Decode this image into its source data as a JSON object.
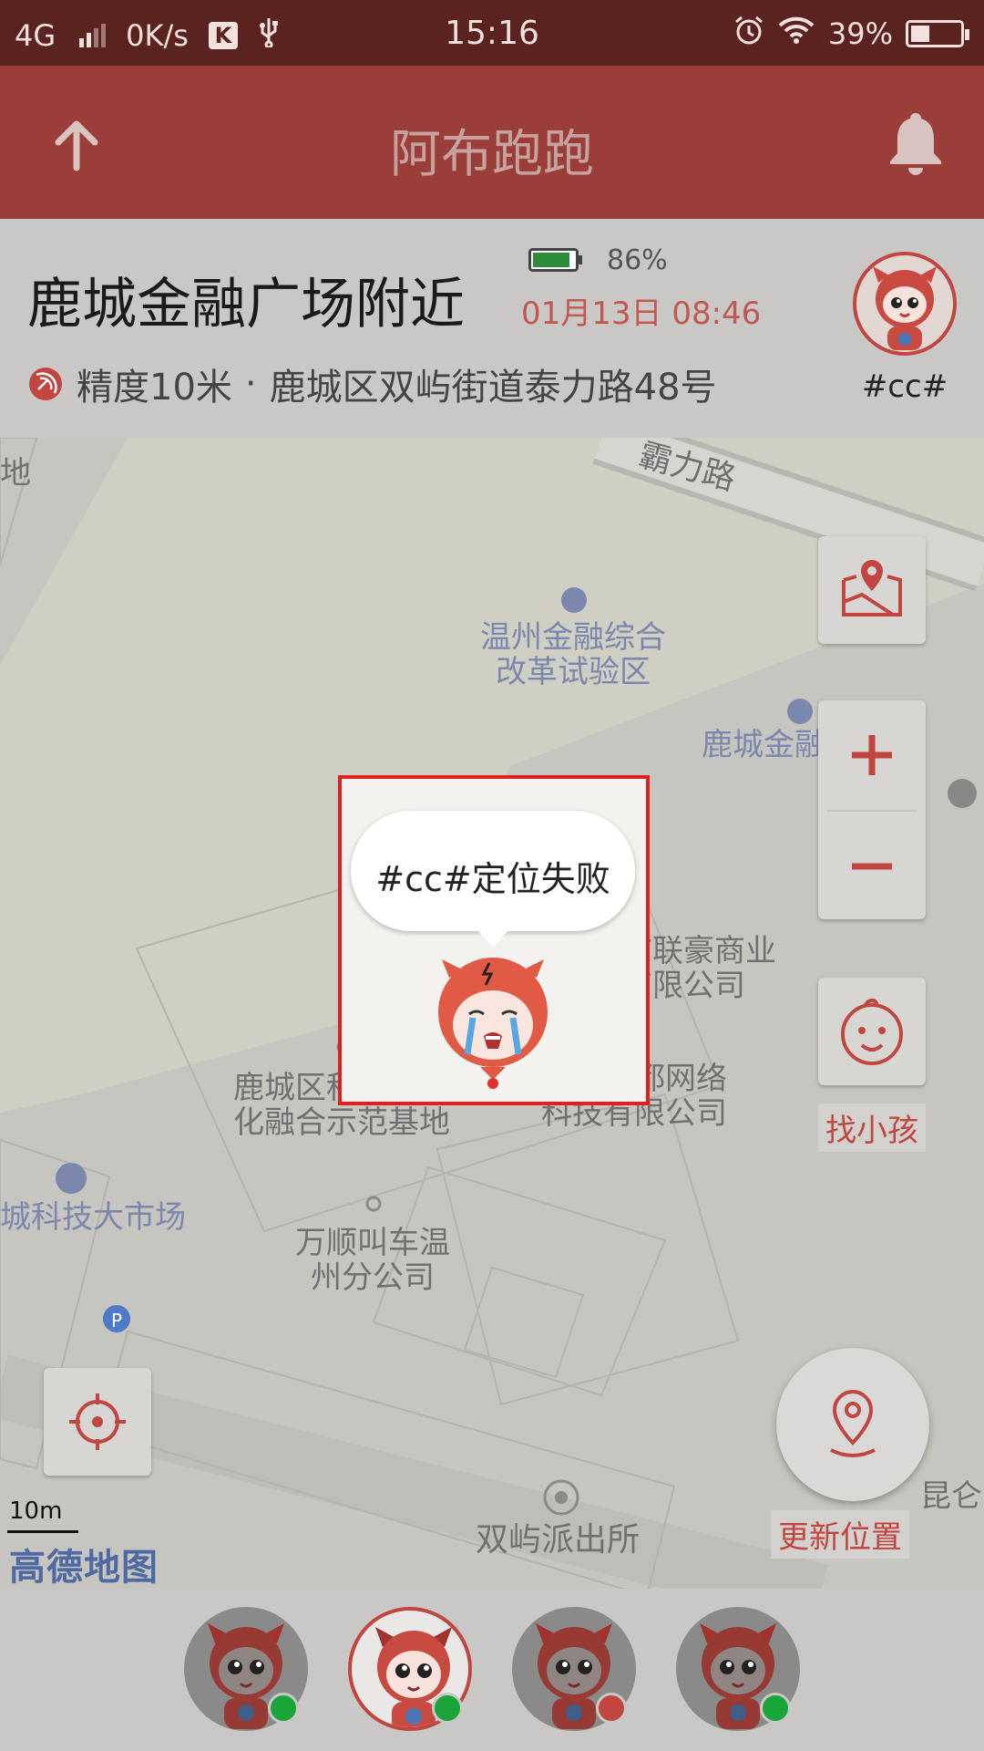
{
  "status_bar": {
    "network": "4G",
    "speed": "0K/s",
    "k_badge": "K",
    "time": "15:16",
    "battery": "39%",
    "battery_level": 0.39
  },
  "app_bar": {
    "title": "阿布跑跑",
    "left_icon": "arrow-up-icon",
    "right_icon": "bell-icon"
  },
  "location": {
    "title": "鹿城金融广场附近",
    "device_battery": "86%",
    "device_battery_level": 0.86,
    "datetime": "01月13日 08:46",
    "accuracy": "精度10米",
    "separator": "·",
    "address": "鹿城区双屿街道泰力路48号",
    "child_name": "#cc#"
  },
  "map": {
    "labels": {
      "road": "霸力路",
      "corner": "地",
      "poi1_line1": "温州金融综合",
      "poi1_line2": "改革试验区",
      "poi2": "鹿城金融",
      "poi3_line1": "温州市联豪商业",
      "poi3_line2": "保理有限公司",
      "poi4_line1": "鹿城区科技与文",
      "poi4_line2": "化融合示范基地",
      "poi5_line1": "温州鞋都网络",
      "poi5_line2": "科技有限公司",
      "poi6": "城科技大市场",
      "poi7_line1": "万顺叫车温",
      "poi7_line2": "州分公司",
      "poi8": "双屿派出所",
      "poi9": "昆仑"
    },
    "scale": "10m",
    "provider": "高德地图",
    "find_child_label": "找小孩",
    "update_location_label": "更新位置"
  },
  "popup": {
    "message": "#cc#定位失败"
  },
  "colors": {
    "brand": "#9b3e39",
    "accent": "#c0463f",
    "online": "#1aa53a",
    "offline": "#c0463f"
  },
  "children": [
    {
      "status": "online",
      "selected": false
    },
    {
      "status": "online",
      "selected": true
    },
    {
      "status": "offline",
      "selected": false
    },
    {
      "status": "online",
      "selected": false
    }
  ]
}
